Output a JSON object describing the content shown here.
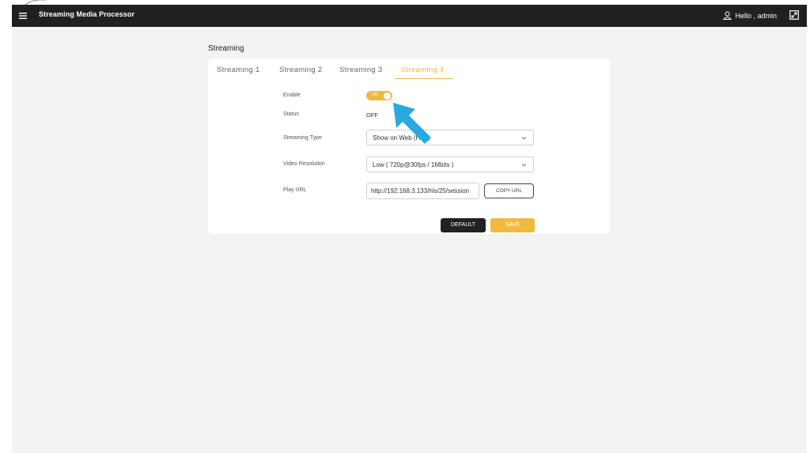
{
  "header": {
    "app_title": "Streaming Media Processor",
    "greeting": "Hello , admin"
  },
  "page": {
    "section_title": "Streaming"
  },
  "tabs": [
    {
      "label": "Streaming 1",
      "active": false
    },
    {
      "label": "Streaming 2",
      "active": false
    },
    {
      "label": "Streaming 3",
      "active": false
    },
    {
      "label": "Streaming 4",
      "active": true
    }
  ],
  "form": {
    "enable_label": "Enable",
    "enable_toggle_text": "ON",
    "enable_state": true,
    "status_label": "Status",
    "status_value": "OFF",
    "streaming_type_label": "Streaming Type",
    "streaming_type_value": "Show on Web (HLS)",
    "video_resolution_label": "Video Resolution",
    "video_resolution_value": "Low ( 720p@30fps / 1Mbits )",
    "play_url_label": "Play URL",
    "play_url_value": "http://192.168.3.133/hls/25/session",
    "copy_url_label": "COPY URL"
  },
  "actions": {
    "default_label": "DEFAULT",
    "save_label": "SAVE"
  },
  "colors": {
    "accent": "#f0b840",
    "topbar": "#202022",
    "annotation_arrow": "#29a9e0"
  },
  "icons": [
    "hamburger-menu-icon",
    "user-icon",
    "expand-icon",
    "chevron-down-icon",
    "pointer-arrow-icon"
  ]
}
